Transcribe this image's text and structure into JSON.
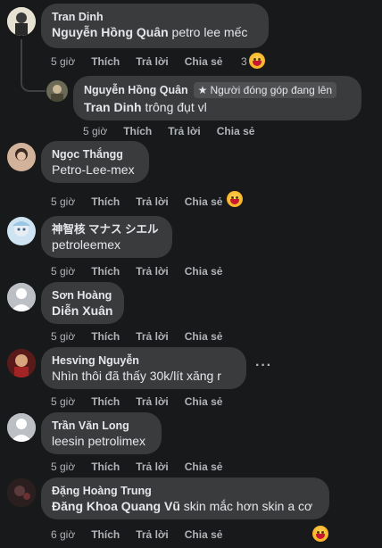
{
  "comments": [
    {
      "author": "Tran Dinh",
      "mention": "Nguyễn Hồng Quân",
      "text": " petro lee mếc",
      "time": "5 giờ",
      "like": "Thích",
      "reply": "Trả lời",
      "share": "Chia sẻ",
      "reactions": "3",
      "avatar_color": "#b9b9a5"
    },
    {
      "author": "Nguyễn Hồng Quân",
      "badge": "Người đóng góp đang lên",
      "mention": "Tran Dinh",
      "text": " trông đụt vl",
      "time": "5 giờ",
      "like": "Thích",
      "reply": "Trả lời",
      "share": "Chia sẻ",
      "avatar_color": "#7a7560"
    },
    {
      "author": "Ngọc Thắngg",
      "text": "Petro-Lee-mex",
      "time": "5 giờ",
      "like": "Thích",
      "reply": "Trả lời",
      "share": "Chia sẻ",
      "avatar_color": "#c09a80"
    },
    {
      "author": "神智核 マナス シエル",
      "text": "petroleemex",
      "time": "5 giờ",
      "like": "Thích",
      "reply": "Trả lời",
      "share": "Chia sẻ",
      "avatar_color": "#b7d6ea"
    },
    {
      "author": "Sơn Hoàng",
      "mention": "Diễn Xuân",
      "text": "",
      "time": "5 giờ",
      "like": "Thích",
      "reply": "Trả lời",
      "share": "Chia sẻ",
      "avatar_color": "#bcc0c4"
    },
    {
      "author": "Hesving Nguyễn",
      "text": "Nhìn thôi đã thấy 30k/lít xăng r",
      "time": "5 giờ",
      "like": "Thích",
      "reply": "Trả lời",
      "share": "Chia sẻ",
      "more": "···",
      "avatar_color": "#8a2a2a"
    },
    {
      "author": "Trần Văn Long",
      "text": "leesin petrolimex",
      "time": "5 giờ",
      "like": "Thích",
      "reply": "Trả lời",
      "share": "Chia sẻ",
      "avatar_color": "#bcc0c4"
    },
    {
      "author": "Đặng Hoàng Trung",
      "mention": "Đăng Khoa Quang Vũ",
      "text": " skin mắc hơn skin a cơ",
      "time": "6 giờ",
      "like": "Thích",
      "reply": "Trả lời",
      "share": "Chia sẻ",
      "avatar_color": "#3b2a2a"
    }
  ],
  "icons": {
    "badge_icon": "star-badge-icon",
    "reaction": "haha-reaction-icon",
    "avatar_placeholder": "person-silhouette-icon"
  }
}
